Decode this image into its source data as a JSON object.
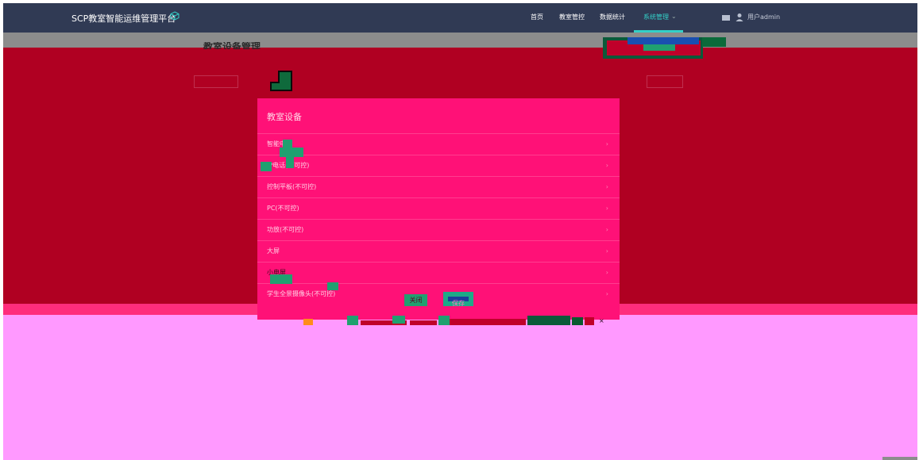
{
  "app": {
    "title": "SCP教室智能运维管理平台"
  },
  "nav": {
    "items": [
      {
        "label": "首页",
        "active": false
      },
      {
        "label": "教室管控",
        "active": false
      },
      {
        "label": "数据统计",
        "active": false
      },
      {
        "label": "系统管理",
        "active": true
      }
    ],
    "user_label": "用户admin"
  },
  "page": {
    "title": "教室设备管理"
  },
  "modal": {
    "title": "教室设备",
    "items": [
      {
        "label": "智能中控"
      },
      {
        "label": "IP电话(不可控)"
      },
      {
        "label": "控制平板(不可控)"
      },
      {
        "label": "PC(不可控)"
      },
      {
        "label": "功放(不可控)"
      },
      {
        "label": "大屏"
      },
      {
        "label": "小电屏"
      },
      {
        "label": "学生全景摄像头(不可控)"
      }
    ],
    "close_label": "关闭",
    "save_label": "保存"
  },
  "colors": {
    "topbar": "#303a54",
    "accent": "#33d0c8",
    "modal_bg": "#ff1177",
    "overlay": "#b00022",
    "lower_overlay": "#ff99ff"
  },
  "icons": [
    "cube-icon",
    "chevron-down-icon",
    "mail-icon",
    "user-icon",
    "chevron-right-icon"
  ]
}
